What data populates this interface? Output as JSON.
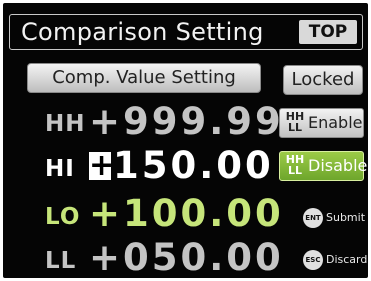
{
  "header": {
    "title": "Comparison Setting",
    "top_label": "TOP"
  },
  "sub_header": {
    "label": "Comp. Value Setting"
  },
  "lock_button": {
    "label": "Locked"
  },
  "rows": [
    {
      "label": "HH",
      "value": "+999.99"
    },
    {
      "label": "HI",
      "sign": "+",
      "value": "150.00"
    },
    {
      "label": "LO",
      "value": "+100.00"
    },
    {
      "label": "LL",
      "value": "+050.00"
    }
  ],
  "mode_buttons": [
    {
      "icon_text": "HH\nLL",
      "label": "Enable"
    },
    {
      "icon_text": "HH\nLL",
      "label": "Disable"
    }
  ],
  "keys": [
    {
      "icon": "ENT",
      "label": "Submit"
    },
    {
      "icon": "ESC",
      "label": "Discard"
    }
  ],
  "colors": {
    "background": "#050505",
    "highlight_green": "#c6e57a",
    "disable_green": "#86b83a",
    "grey_text": "#c4c4c4"
  }
}
